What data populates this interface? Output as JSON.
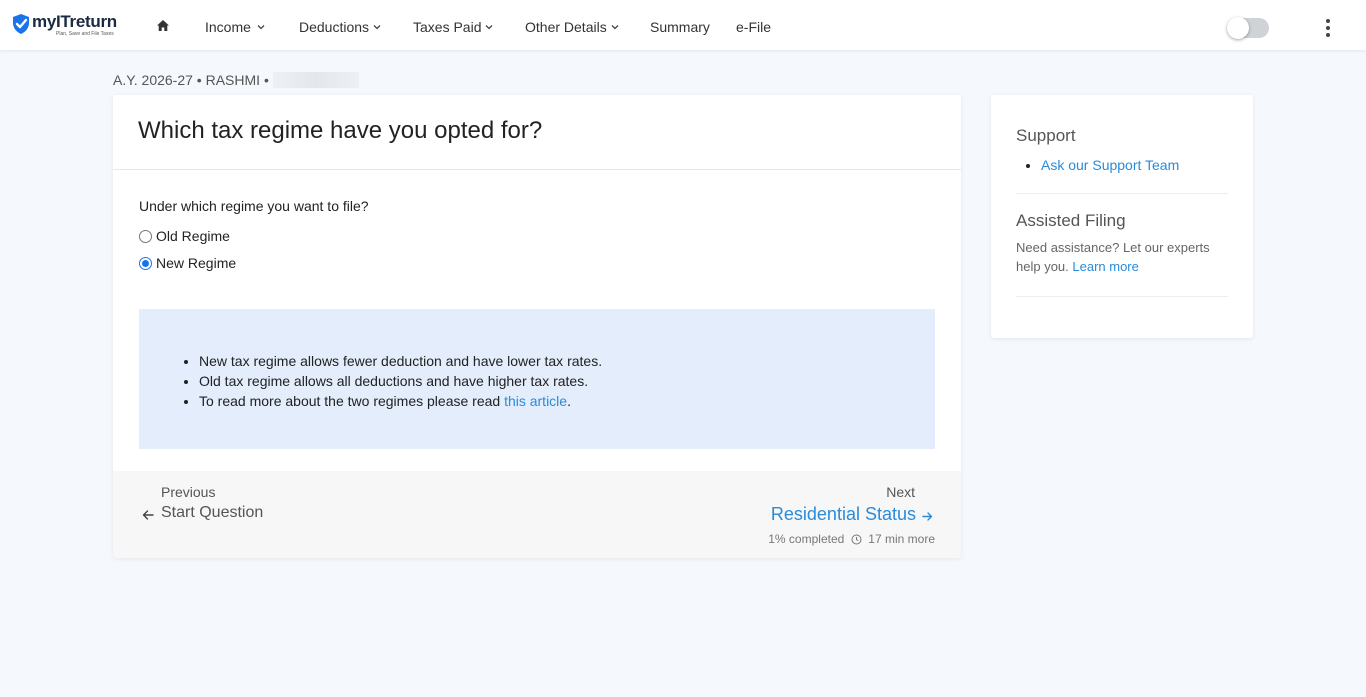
{
  "brand": {
    "name": "myITreturn",
    "tagline": "Plan, Save and File Taxes",
    "color": "#1a73e8"
  },
  "nav": {
    "items": [
      {
        "label": "Income",
        "dropdown": true
      },
      {
        "label": "Deductions",
        "dropdown": true
      },
      {
        "label": "Taxes Paid",
        "dropdown": true
      },
      {
        "label": "Other Details",
        "dropdown": true
      },
      {
        "label": "Summary",
        "dropdown": false
      },
      {
        "label": "e-File",
        "dropdown": false
      }
    ],
    "toggle_on": false
  },
  "breadcrumb": {
    "text": "A.Y. 2026-27 • RASHMI •"
  },
  "main": {
    "title": "Which tax regime have you opted for?",
    "question": "Under which regime you want to file?",
    "options": [
      {
        "label": "Old Regime",
        "selected": false
      },
      {
        "label": "New Regime",
        "selected": true
      }
    ],
    "info": {
      "line1": "New tax regime allows fewer deduction and have lower tax rates.",
      "line2": "Old tax regime allows all deductions and have higher tax rates.",
      "line3_prefix": "To read more about the two regimes please read ",
      "line3_link": "this article",
      "line3_suffix": "."
    },
    "footer": {
      "prev_label": "Previous",
      "prev_text": "Start Question",
      "next_label": "Next",
      "next_text": "Residential Status",
      "progress": "1% completed",
      "time_left": "17 min more"
    }
  },
  "sidebar": {
    "support_title": "Support",
    "support_link": "Ask our Support Team",
    "assisted_title": "Assisted Filing",
    "assisted_text": "Need assistance? Let our experts help you.",
    "assisted_link": "Learn more"
  }
}
